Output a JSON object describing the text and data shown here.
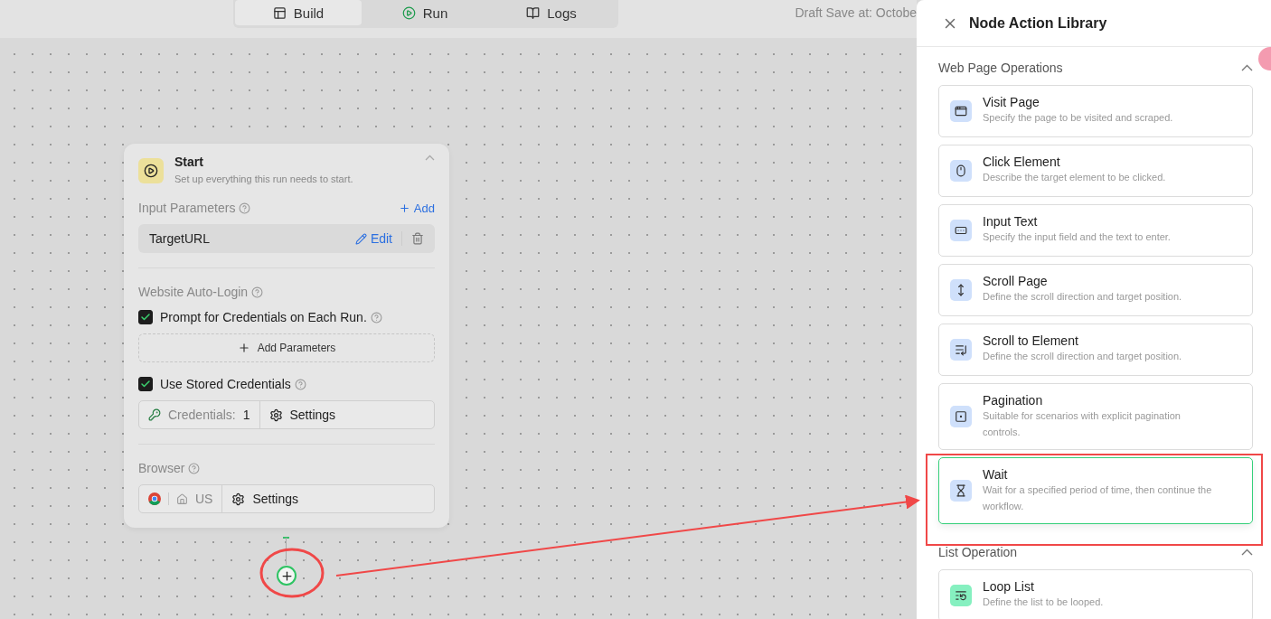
{
  "tabs": [
    {
      "label": "Build",
      "selected": true
    },
    {
      "label": "Run",
      "selected": false
    },
    {
      "label": "Logs",
      "selected": false
    }
  ],
  "draft_save": "Draft Save at: Octobe",
  "start_node": {
    "title": "Start",
    "subtitle": "Set up everything this run needs to start.",
    "expanded": true,
    "input_parameters": {
      "label": "Input Parameters",
      "add": "Add",
      "params": [
        {
          "name": "TargetURL",
          "edit": "Edit"
        }
      ]
    },
    "auto_login": {
      "label": "Website Auto-Login",
      "prompt": {
        "label": "Prompt for Credentials on Each Run.",
        "checked": true
      },
      "add_parameters": "Add Parameters",
      "stored": {
        "label": "Use Stored Credentials",
        "checked": true
      },
      "credentials_label": "Credentials:",
      "credentials_count": "1",
      "settings": "Settings"
    },
    "browser": {
      "label": "Browser",
      "region": "US",
      "settings": "Settings"
    }
  },
  "panel": {
    "title": "Node Action Library",
    "sections": [
      {
        "title": "Web Page Operations",
        "expanded": true,
        "items": [
          {
            "kind": "visit",
            "title": "Visit Page",
            "description": "Specify the page to be visited and scraped.",
            "color": "#cfe0fb",
            "selected": false
          },
          {
            "kind": "click",
            "title": "Click Element",
            "description": "Describe the target element to be clicked.",
            "color": "#cfe0fb",
            "selected": false
          },
          {
            "kind": "input",
            "title": "Input Text",
            "description": "Specify the input field and the text to enter.",
            "color": "#cfe0fb",
            "selected": false
          },
          {
            "kind": "scroll",
            "title": "Scroll Page",
            "description": "Define the scroll direction and target position.",
            "color": "#cfe0fb",
            "selected": false
          },
          {
            "kind": "scroll_element",
            "title": "Scroll to Element",
            "description": "Define the scroll direction and target position.",
            "color": "#cfe0fb",
            "selected": false
          },
          {
            "kind": "pagination",
            "title": "Pagination",
            "description": "Suitable for scenarios with explicit pagination controls.",
            "color": "#cfe0fb",
            "selected": false
          },
          {
            "kind": "wait",
            "title": "Wait",
            "description": "Wait for a specified period of time, then continue the workflow.",
            "color": "#cfe0fb",
            "selected": true
          }
        ]
      },
      {
        "title": "List Operation",
        "expanded": true,
        "items": [
          {
            "kind": "loop",
            "title": "Loop List",
            "description": "Define the list to be looped.",
            "color": "#86f0c0",
            "selected": false
          }
        ]
      }
    ]
  }
}
